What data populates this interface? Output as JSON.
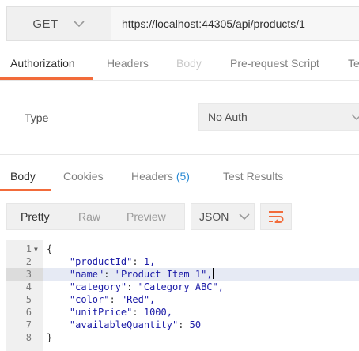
{
  "request": {
    "method": "GET",
    "url": "https://localhost:44305/api/products/1"
  },
  "request_tabs": [
    {
      "label": "Authorization",
      "state": "active"
    },
    {
      "label": "Headers",
      "state": "normal"
    },
    {
      "label": "Body",
      "state": "disabled"
    },
    {
      "label": "Pre-request Script",
      "state": "normal"
    },
    {
      "label": "Te",
      "state": "normal"
    }
  ],
  "auth": {
    "type_label": "Type",
    "type_value": "No Auth"
  },
  "response_tabs": [
    {
      "label": "Body",
      "state": "active"
    },
    {
      "label": "Cookies",
      "state": "normal"
    },
    {
      "label": "Headers",
      "count": "(5)",
      "state": "normal"
    },
    {
      "label": "Test Results",
      "state": "normal"
    }
  ],
  "response_toolbar": {
    "views": [
      "Pretty",
      "Raw",
      "Preview"
    ],
    "active_view": "Pretty",
    "format": "JSON",
    "wrap_icon": "wrap-lines-icon"
  },
  "editor": {
    "highlighted_line": 3,
    "lines": [
      {
        "n": "1",
        "text": "{"
      },
      {
        "n": "2",
        "key": "\"productId\"",
        "value": "1,"
      },
      {
        "n": "3",
        "key": "\"name\"",
        "value": "\"Product Item 1\","
      },
      {
        "n": "4",
        "key": "\"category\"",
        "value": "\"Category ABC\","
      },
      {
        "n": "5",
        "key": "\"color\"",
        "value": "\"Red\","
      },
      {
        "n": "6",
        "key": "\"unitPrice\"",
        "value": "1000,"
      },
      {
        "n": "7",
        "key": "\"availableQuantity\"",
        "value": "50"
      },
      {
        "n": "8",
        "text": "}"
      }
    ]
  },
  "colors": {
    "accent": "#f26b3a",
    "count": "#2a8ad4",
    "json_text": "#1a1aa6"
  }
}
